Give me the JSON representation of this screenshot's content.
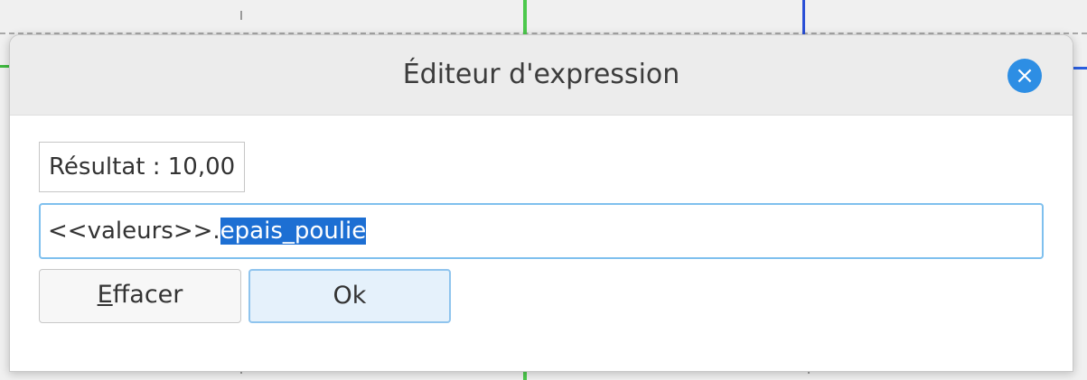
{
  "dialog": {
    "title": "Éditeur d'expression",
    "close_symbol": "×",
    "result_text": "Résultat : 10,00",
    "expression_prefix": "<<valeurs>>.",
    "expression_selected": "epais_poulie",
    "clear_mnemonic": "E",
    "clear_rest": "ffacer",
    "ok_label": "Ok"
  },
  "colors": {
    "accent": "#2d8ee4",
    "selection": "#1d6fd3",
    "input_border": "#7fc0ee"
  },
  "icons": {
    "close": "close-icon"
  }
}
